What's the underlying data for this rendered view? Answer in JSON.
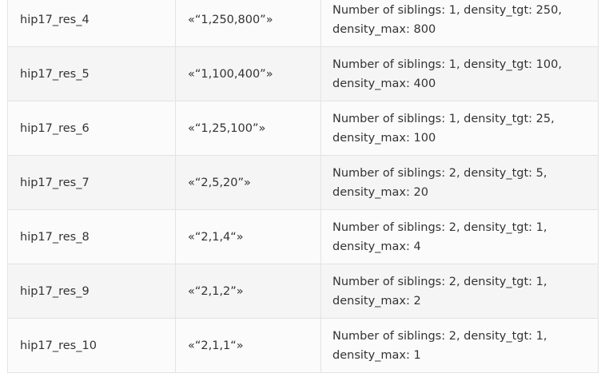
{
  "table": {
    "rows": [
      {
        "name": "hip17_res_4",
        "value": "«“1,250,800”»",
        "description": "Number of siblings: 1, density_tgt: 250, density_max: 800"
      },
      {
        "name": "hip17_res_5",
        "value": "«“1,100,400”»",
        "description": "Number of siblings: 1, density_tgt: 100, density_max: 400"
      },
      {
        "name": "hip17_res_6",
        "value": "«“1,25,100”»",
        "description": "Number of siblings: 1, density_tgt: 25, density_max: 100"
      },
      {
        "name": "hip17_res_7",
        "value": "«“2,5,20”»",
        "description": "Number of siblings: 2, density_tgt: 5, density_max: 20"
      },
      {
        "name": "hip17_res_8",
        "value": "«“2,1,4“»",
        "description": "Number of siblings: 2, density_tgt: 1, density_max: 4"
      },
      {
        "name": "hip17_res_9",
        "value": "«“2,1,2”»",
        "description": "Number of siblings: 2, density_tgt: 1, density_max: 2"
      },
      {
        "name": "hip17_res_10",
        "value": "«“2,1,1“»",
        "description": "Number of siblings: 2, density_tgt: 1, density_max: 1"
      }
    ]
  }
}
